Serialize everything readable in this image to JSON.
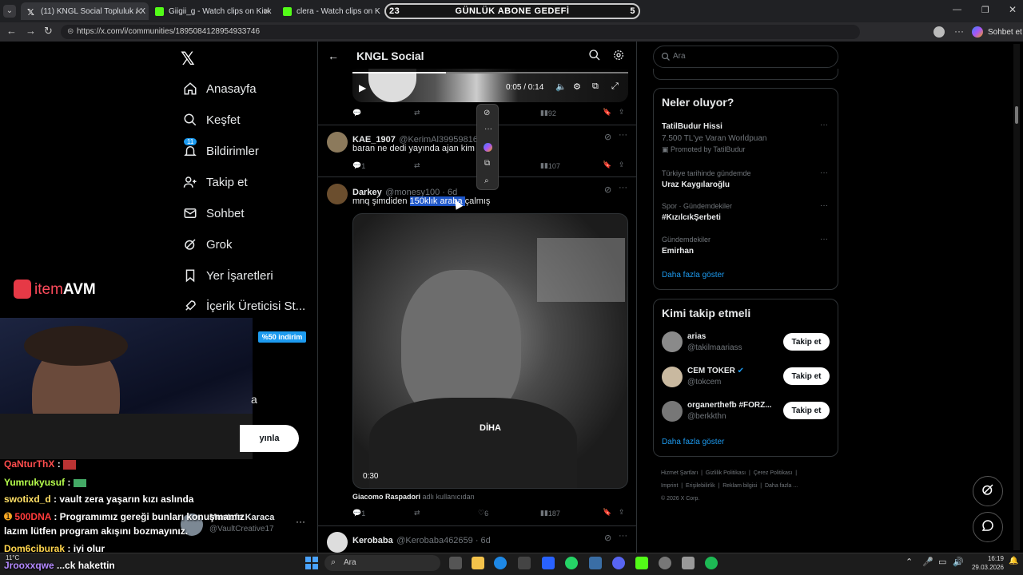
{
  "browser": {
    "tabs": [
      {
        "title": "(11) KNGL Social Topluluk / X",
        "active": true
      },
      {
        "title": "Giigii_g - Watch clips on Kick",
        "active": false
      },
      {
        "title": "clera - Watch clips on Kick",
        "active": false
      }
    ],
    "url": "https://x.com/i/communities/1895084128954933746",
    "copilot_label": "Sohbet et"
  },
  "overlay": {
    "goal_left": "23",
    "goal_title": "GÜNLÜK ABONE GEDEFİ",
    "goal_right": "5",
    "brand_icon": "item-bag-icon",
    "brand_text_a": "item",
    "brand_text_b": "AVM",
    "discount_badge": "%50 indirim"
  },
  "nav": {
    "items": [
      {
        "label": "Anasayfa",
        "icon": "home-icon"
      },
      {
        "label": "Keşfet",
        "icon": "search-icon"
      },
      {
        "label": "Bildirimler",
        "icon": "bell-icon",
        "badge": "11"
      },
      {
        "label": "Takip et",
        "icon": "person-add-icon"
      },
      {
        "label": "Sohbet",
        "icon": "mail-icon"
      },
      {
        "label": "Grok",
        "icon": "grok-icon"
      },
      {
        "label": "Yer İşaretleri",
        "icon": "bookmark-icon"
      },
      {
        "label": "İçerik Üreticisi St...",
        "icon": "rocket-icon"
      }
    ],
    "post_button_fragment": "yınla",
    "account_fragment": "a",
    "account_name": "Mustafa Karaca",
    "account_handle": "@VaultCreative17",
    "account_more": "···"
  },
  "header": {
    "title": "KNGL Social"
  },
  "video_top": {
    "time": "0:05 / 0:14",
    "views": "92"
  },
  "posts": [
    {
      "name": "KAE_1907",
      "handle": "@KerimAl39959816 · 5",
      "text": "baran ne dedi yayında ajan kim aq",
      "text_tail": "o",
      "replies": "1",
      "views": "107"
    },
    {
      "name": "Darkey",
      "handle": "@monesy100 · 6d",
      "text_pre": "mnq şimdiden ",
      "text_sel": "150klık araba ",
      "text_post": "çalmış",
      "video_time": "0:30",
      "video_tag": "DİHA",
      "tag_user": "Giacomo Raspadori",
      "tag_suffix": "adlı kullanıcıdan",
      "replies": "1",
      "likes": "6",
      "views": "187"
    },
    {
      "name": "Kerobaba",
      "handle": "@Kerobaba462659 · 6d"
    }
  ],
  "search": {
    "placeholder": "Ara"
  },
  "trends": {
    "title": "Neler oluyor?",
    "items": [
      {
        "top": "TatilBudur Hissi",
        "mid": "7.500 TL'ye Varan Worldpuan",
        "bottom": "Promoted by TatilBudur"
      },
      {
        "top": "Türkiye tarihinde gündemde",
        "mid": "Uraz Kaygılaroğlu"
      },
      {
        "top": "Spor · Gündemdekiler",
        "mid": "#KızılcıkŞerbeti"
      },
      {
        "top": "Gündemdekiler",
        "mid": "Emirhan"
      }
    ],
    "more": "Daha fazla göster"
  },
  "who_to_follow": {
    "title": "Kimi takip etmeli",
    "items": [
      {
        "name": "arias",
        "handle": "@takilmaariass",
        "button": "Takip et"
      },
      {
        "name": "CEM TOKER",
        "handle": "@tokcem",
        "button": "Takip et"
      },
      {
        "name": "organerthefb #FORZ...",
        "handle": "@berkkthn",
        "button": "Takip et"
      }
    ],
    "more": "Daha fazla göster"
  },
  "footer": {
    "line1": [
      "Hizmet Şartları",
      "Gizlilik Politikası",
      "Çerez Politikası"
    ],
    "line2": [
      "Imprint",
      "Erişilebilirlik",
      "Reklam bilgisi",
      "Daha fazla ..."
    ],
    "copyright": "© 2026 X Corp."
  },
  "chat": [
    {
      "user": "QaNturThX",
      "msg": ":",
      "color": "#ff4d4d"
    },
    {
      "user": "Yumrukyusuf",
      "msg": ":",
      "color": "#b7ff4d"
    },
    {
      "user": "swotixd_d",
      "msg": ": vault zera yaşarın kızı aslında",
      "color": "#ffe066"
    },
    {
      "user": "500DNA",
      "msg": ": Programımız gereği bunları konuşmamız",
      "color": "#ff3b3b"
    },
    {
      "user": "",
      "msg": "lazım lütfen program akışını bozmayınız.",
      "color": "#fff"
    },
    {
      "user": "Dom6ciburak",
      "msg": ": iyi olur",
      "color": "#ffd54d"
    },
    {
      "user": "Jrooxxqwe",
      "msg": "...ck hakettin",
      "color": "#b388ff"
    }
  ],
  "taskbar": {
    "search_placeholder": "Ara",
    "time": "16:19",
    "date": "29.03.2026",
    "weather": "11°C"
  }
}
